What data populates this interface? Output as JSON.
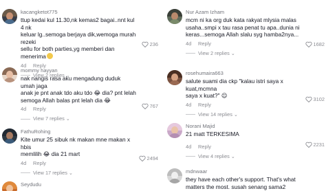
{
  "left_column": [
    {
      "username": "kacangketot775",
      "lines": [
        "ttup kedai kul 11.30,nk kemas2 bagai..nnt kul 4 nk",
        "keluar lg..semoga berjaya dik,wemoga murah rezeki",
        "sellu for both parties,yg memberi dan menerima"
      ],
      "emoji": "folded-hands",
      "date": "4d",
      "reply_label": "Reply",
      "likes": "236",
      "view_replies": "View 2 replies"
    },
    {
      "username": "mommy hayyan",
      "lines": [
        "nak nangis rasa aku mengadung duduk umah jaga",
        "anak je pnt anak tdo aku tdo 😂 dia? pnt lelah",
        "semoga Allah balas pnt lelah dia 😂"
      ],
      "date": "4d",
      "reply_label": "Reply",
      "likes": "767",
      "view_replies": "View 7 replies"
    },
    {
      "username": "FathuRohing",
      "lines": [
        "Kite umur 25 sibuk nk makan mne makan x hbis",
        "memlilih 😂 dia 21 mart"
      ],
      "date": "4d",
      "reply_label": "Reply",
      "likes": "2494",
      "view_replies": "View 17 replies"
    },
    {
      "username": "Seydudu"
    }
  ],
  "right_column": [
    {
      "username": "Nur Azam Izham",
      "lines": [
        "mcm ni ka org duk kata rakyat mlysia malas",
        "usaha..smpi x tau rasa penat tu apa..dunia ni",
        "keras...semoga Allah slalu syg hamba2nya..."
      ],
      "date": "4d",
      "reply_label": "Reply",
      "likes": "1682",
      "view_replies": "View 2 replies"
    },
    {
      "username": "rosehumaira663",
      "lines": [
        "salute suami dia ckp \"kalau istri saya x kuat,mcmna",
        "saya x kuat?\" 😌"
      ],
      "date": "4d",
      "reply_label": "Reply",
      "likes": "3102",
      "view_replies": "View 14 replies"
    },
    {
      "username": "Norani Majid",
      "lines": [
        "21 matt TERKESIMA"
      ],
      "date": "4d",
      "reply_label": "Reply",
      "likes": "2231",
      "view_replies": "View 4 replies"
    },
    {
      "username": "mdnwaar",
      "lines": [
        "they have each other's support. That's what",
        "matters the most. susah senang sama2"
      ]
    }
  ],
  "colors": {
    "text_primary": "#161823",
    "text_secondary": "#8a8b91",
    "folded_hands_emoji": "#f2c94c"
  }
}
